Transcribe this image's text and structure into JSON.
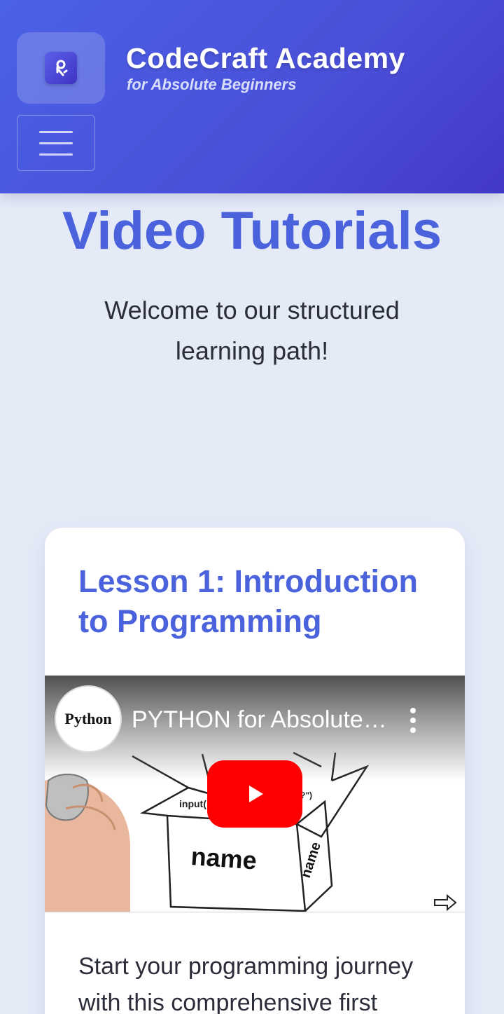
{
  "header": {
    "brand_title": "CodeCraft Academy",
    "brand_subtitle": "for Absolute Beginners",
    "logo_icon": "code-person-icon",
    "menu_icon": "hamburger-menu-icon",
    "gradient_colors": [
      "#4a62e6",
      "#4238c8"
    ]
  },
  "main": {
    "title": "Video Tutorials",
    "welcome": "Welcome to our structured learning path!"
  },
  "lesson": {
    "title": "Lesson 1: Introduction to Programming",
    "video": {
      "title": "PYTHON for Absolute Beginners",
      "channel_logo_text": "Python",
      "thumbnail_words": [
        "input",
        "name",
        "name"
      ],
      "play_icon": "youtube-play-icon",
      "more_icon": "more-vertical-icon",
      "share_icon": "share-arrow-icon",
      "play_color": "#ff0000"
    },
    "description": "Start your programming journey with this comprehensive first"
  },
  "colors": {
    "accent": "#4a62dc",
    "background": "#e5eaf7",
    "text": "#2b2d3a"
  }
}
